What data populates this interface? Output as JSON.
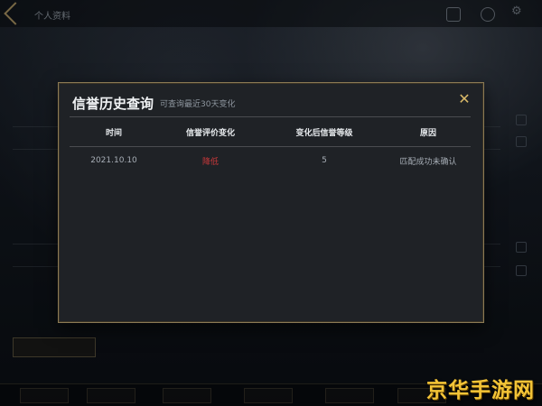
{
  "background": {
    "topbar_title": "个人资料"
  },
  "dialog": {
    "title": "信誉历史查询",
    "subtitle": "可查询最近30天变化",
    "close_glyph": "✕",
    "columns": [
      "时间",
      "信誉评价变化",
      "变化后信誉等级",
      "原因"
    ],
    "rows": [
      {
        "time": "2021.10.10",
        "change": "降低",
        "level": "5",
        "reason": "匹配成功未确认"
      }
    ]
  },
  "watermark": "京华手游网",
  "colors": {
    "accent_gold": "#d9b968",
    "decrease_red": "#c9383a",
    "dialog_bg": "#1f2226",
    "watermark_yellow": "#f3c437"
  }
}
